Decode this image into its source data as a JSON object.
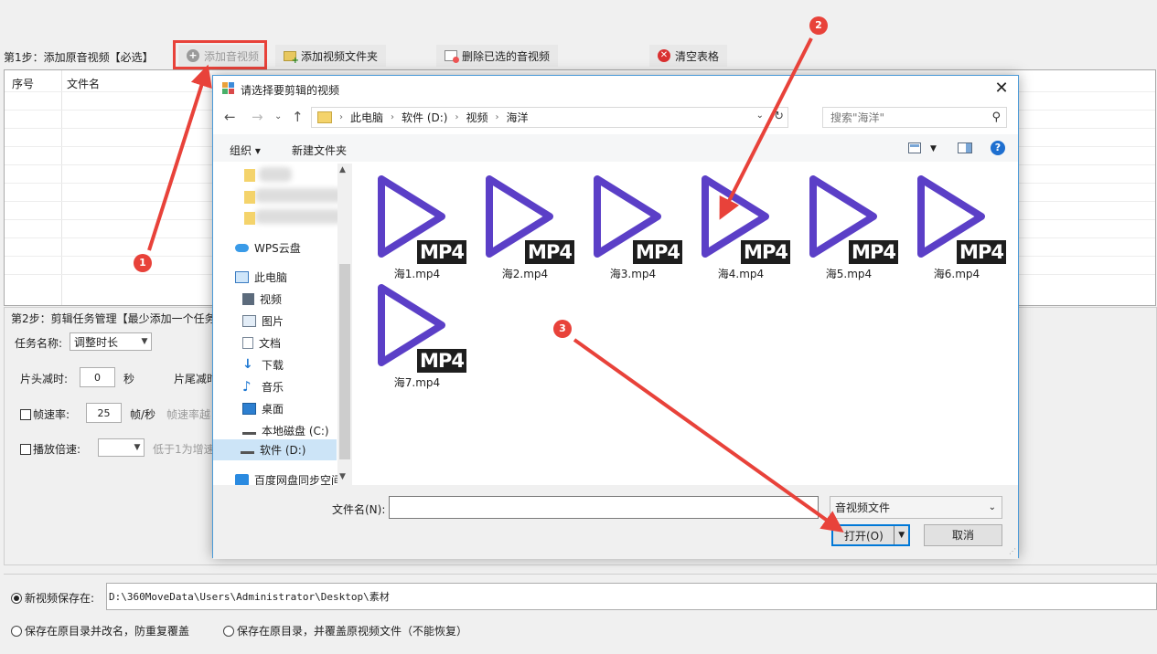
{
  "step1": {
    "label": "第1步：添加原音视频【必选】",
    "buttons": {
      "add_audio_video": "添加音视频",
      "add_video_folder": "添加视频文件夹",
      "delete_selected": "删除已选的音视频",
      "clear_table": "清空表格"
    },
    "table": {
      "col_index": "序号",
      "col_filename": "文件名"
    }
  },
  "step2": {
    "label": "第2步：剪辑任务管理【最少添加一个任务",
    "task_name_label": "任务名称:",
    "task_name_value": "调整时长",
    "head_cut_label": "片头减时:",
    "head_cut_value": "0",
    "seconds_unit": "秒",
    "tail_cut_label": "片尾减时",
    "frame_rate_label": "帧速率:",
    "frame_rate_value": "25",
    "frame_rate_unit": "帧/秒",
    "frame_rate_hint": "帧速率越",
    "speed_label": "播放倍速:",
    "speed_value": "",
    "speed_hint": "低于1为增速"
  },
  "save": {
    "new_save_label": "新视频保存在:",
    "path": "D:\\360MoveData\\Users\\Administrator\\Desktop\\素材",
    "option_rename": "保存在原目录并改名，防重复覆盖",
    "option_overwrite": "保存在原目录，并覆盖原视频文件（不能恢复）"
  },
  "dialog": {
    "title": "请选择要剪辑的视频",
    "breadcrumb": [
      "此电脑",
      "软件 (D:)",
      "视频",
      "海洋"
    ],
    "search_placeholder": "搜索\"海洋\"",
    "organize": "组织 ▾",
    "new_folder": "新建文件夹",
    "nav_items": [
      "WPS云盘",
      "此电脑",
      "视频",
      "图片",
      "文档",
      "下载",
      "音乐",
      "桌面",
      "本地磁盘 (C:)",
      "软件 (D:)",
      "百度网盘同步空间"
    ],
    "files": [
      "海1.mp4",
      "海2.mp4",
      "海3.mp4",
      "海4.mp4",
      "海5.mp4",
      "海6.mp4",
      "海7.mp4"
    ],
    "file_badge": "MP4",
    "filename_label": "文件名(N):",
    "filename_value": "",
    "filetype": "音视频文件",
    "open_button": "打开(O)",
    "cancel_button": "取消"
  },
  "annotations": {
    "markers": [
      "1",
      "2",
      "3"
    ]
  },
  "colors": {
    "annotation_red": "#e8423a",
    "play_icon_purple": "#5b3fc7",
    "accent_blue": "#0078d7"
  }
}
